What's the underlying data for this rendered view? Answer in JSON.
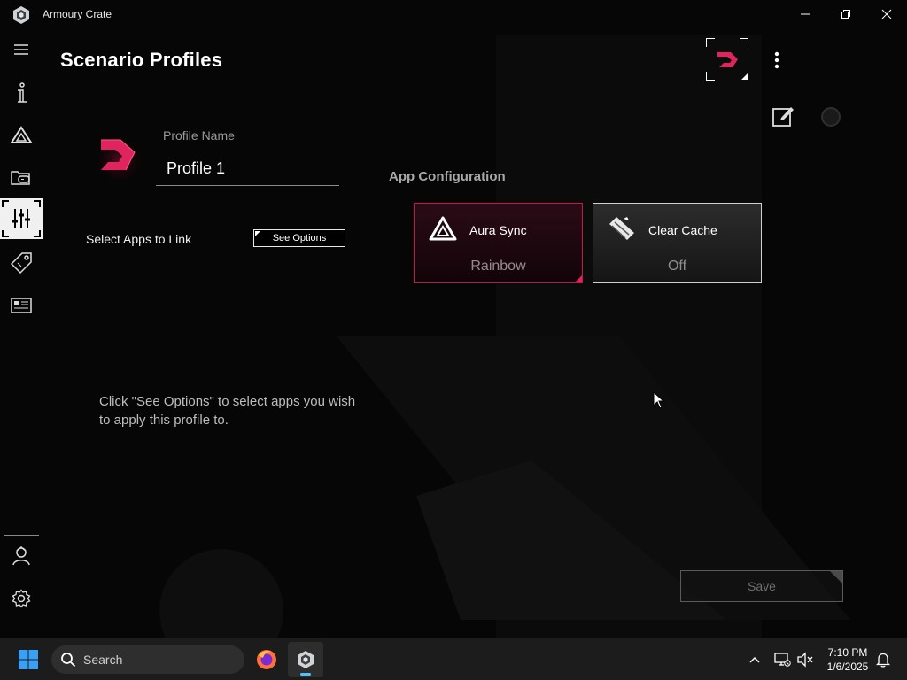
{
  "window": {
    "title": "Armoury Crate",
    "minimize_glyph": "—",
    "maximize_glyph": "❐",
    "close_glyph": "✕"
  },
  "sidebar": {
    "items": [
      {
        "name": "menu",
        "icon": "hamburger-icon"
      },
      {
        "name": "device-info",
        "icon": "info-icon"
      },
      {
        "name": "aura-sync",
        "icon": "aura-sync-icon"
      },
      {
        "name": "game-library",
        "icon": "game-library-icon"
      },
      {
        "name": "scenario-profiles",
        "icon": "sliders-icon",
        "active": true
      },
      {
        "name": "deals",
        "icon": "tag-icon"
      },
      {
        "name": "news",
        "icon": "news-icon"
      },
      {
        "name": "user-center",
        "icon": "user-icon"
      },
      {
        "name": "settings",
        "icon": "gear-icon"
      }
    ]
  },
  "page": {
    "title": "Scenario Profiles"
  },
  "profile": {
    "name_label": "Profile Name",
    "name_value": "Profile 1"
  },
  "apps": {
    "select_label": "Select Apps to Link",
    "see_options_label": "See Options",
    "hint": "Click \"See Options\" to select apps you wish to apply this profile to."
  },
  "config": {
    "heading": "App Configuration",
    "cards": [
      {
        "title": "Aura Sync",
        "value": "Rainbow",
        "icon": "aura-sync-icon",
        "accent": "#c5164a"
      },
      {
        "title": "Clear Cache",
        "value": "Off",
        "icon": "clear-cache-icon"
      }
    ]
  },
  "actions": {
    "save_label": "Save"
  },
  "taskbar": {
    "search_label": "Search",
    "time": "7:10 PM",
    "date": "1/6/2025"
  },
  "colors": {
    "accent_red": "#e0245e",
    "taskbar_highlight": "#4cc2ff"
  }
}
